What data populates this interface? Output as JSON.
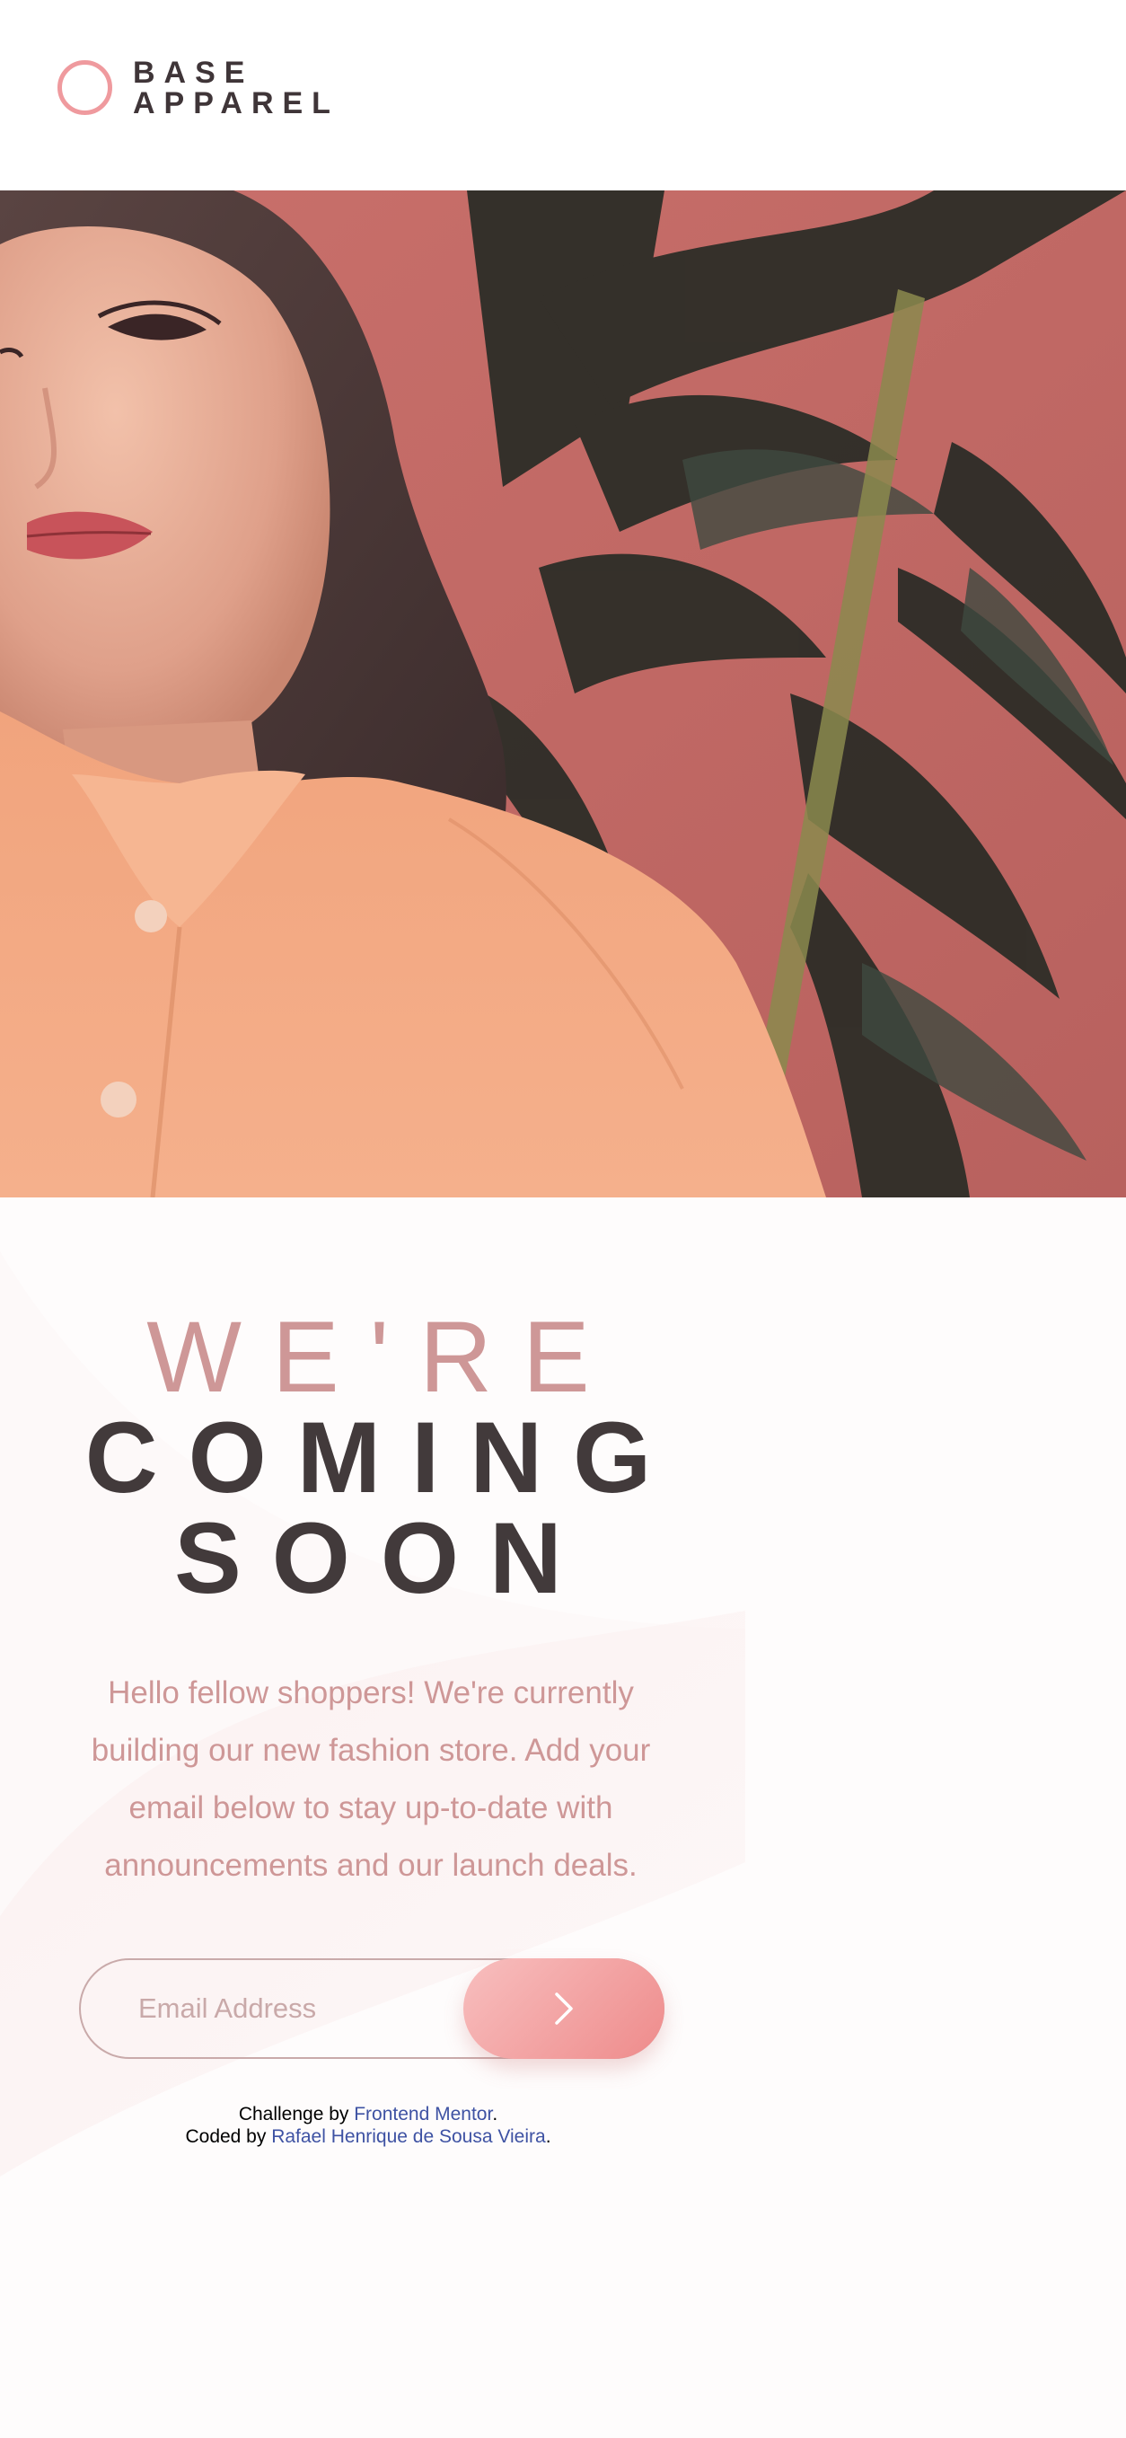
{
  "brand": {
    "line1": "BASE",
    "line2": "APPAREL",
    "accent_color": "#ef9a9e",
    "text_color": "#3f3538"
  },
  "hero": {
    "image_icon": "hero-photo-woman-orange-shirt"
  },
  "headline": {
    "light": "WE'RE",
    "dark_line1": "COMING",
    "dark_line2": "SOON",
    "light_color": "#ce9797",
    "dark_color": "#423a3b"
  },
  "description": "Hello fellow shoppers! We're currently building our new fashion store. Add your email below to stay up-to-date with announcements and our launch deals.",
  "form": {
    "email_placeholder": "Email Address",
    "email_value": "",
    "submit_icon": "chevron-right-icon",
    "gradient_colors": [
      "#f8bfbf",
      "#ee8b8b"
    ]
  },
  "attribution": {
    "challenge_prefix": "Challenge by ",
    "challenge_link": "Frontend Mentor",
    "challenge_suffix": ".",
    "coded_prefix": "Coded by ",
    "coded_link": "Rafael Henrique de Sousa Vieira",
    "coded_suffix": ".",
    "link_color": "#3e52a3"
  }
}
